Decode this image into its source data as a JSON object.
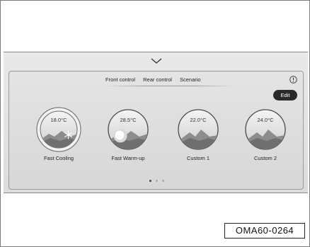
{
  "tabs": [
    {
      "label": "Front control"
    },
    {
      "label": "Rear control"
    },
    {
      "label": "Scenario"
    }
  ],
  "edit_label": "Edit",
  "presets": [
    {
      "temp": "18.0°C",
      "label": "Fast Cooling",
      "icon": "snowflake-icon",
      "selected": true
    },
    {
      "temp": "28.5°C",
      "label": "Fast Warm-up",
      "icon": "sun-icon",
      "selected": false
    },
    {
      "temp": "22.0°C",
      "label": "Custom 1",
      "icon": "mountain-icon",
      "selected": false
    },
    {
      "temp": "24.0°C",
      "label": "Custom 2",
      "icon": "mountain-icon",
      "selected": false
    }
  ],
  "pagination": {
    "pages": 3,
    "current": 1
  },
  "figure_code": "OMA60-0264",
  "colors": {
    "panel": "#e4e4e4",
    "edit_button": "#2a2a2a",
    "dial_ring": "#7a7a7a"
  }
}
